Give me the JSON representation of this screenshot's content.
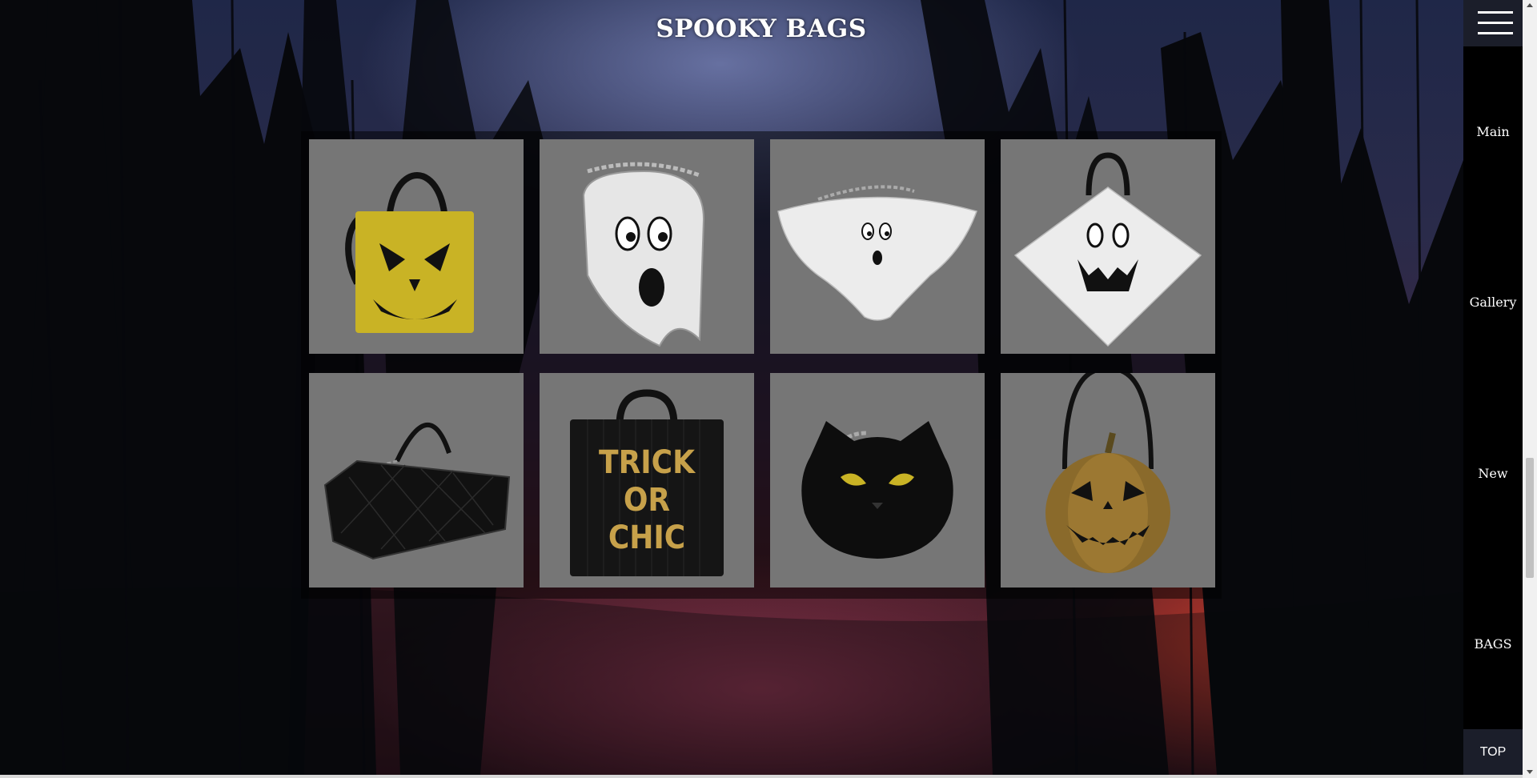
{
  "page": {
    "title": "SPOOKY BAGS"
  },
  "nav": {
    "menu_icon": "hamburger-icon",
    "items": [
      {
        "label": "Main"
      },
      {
        "label": "Gallery"
      },
      {
        "label": "New"
      },
      {
        "label": "BAGS"
      }
    ],
    "top_label": "TOP"
  },
  "gallery": {
    "items": [
      {
        "name": "yellow-jack-o-lantern-tote",
        "icon": "yellow-pumpkin-face-bag"
      },
      {
        "name": "cartoon-ghost-bag",
        "icon": "ghost-face-bag"
      },
      {
        "name": "ghost-clutch-small-face",
        "icon": "ghost-clutch"
      },
      {
        "name": "ghost-bag-jack-face",
        "icon": "ghost-pumpkin-face-bag"
      },
      {
        "name": "quilted-coffin-bag",
        "icon": "coffin-bag"
      },
      {
        "name": "trick-or-chic-tote",
        "icon": "trick-or-chic-bag",
        "print": [
          "TRICK",
          "OR",
          "CHIC"
        ]
      },
      {
        "name": "black-cat-bag",
        "icon": "black-cat-bag"
      },
      {
        "name": "gold-pumpkin-bag",
        "icon": "gold-pumpkin-bag"
      }
    ]
  },
  "colors": {
    "tile_bg": "#767676",
    "nav_bg": "#000000",
    "button_bg": "#1b1e2a",
    "text": "#ffffff"
  }
}
